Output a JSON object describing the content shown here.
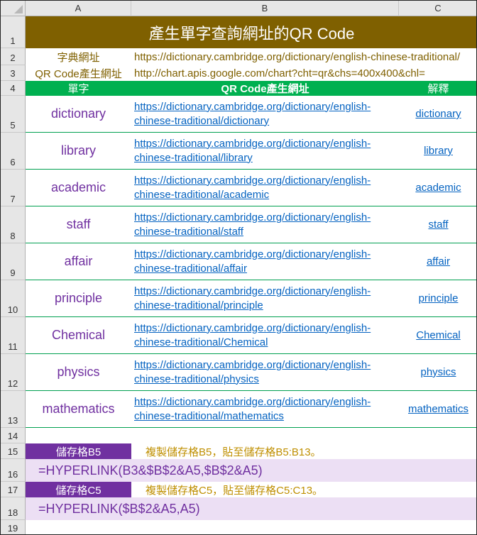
{
  "columns": [
    "A",
    "B",
    "C"
  ],
  "row_numbers": [
    "1",
    "2",
    "3",
    "4",
    "5",
    "6",
    "7",
    "8",
    "9",
    "10",
    "11",
    "12",
    "13",
    "14",
    "15",
    "16",
    "17",
    "18",
    "19"
  ],
  "title": "產生單字查詢網址的QR Code",
  "row2": {
    "label": "字典網址",
    "value": "https://dictionary.cambridge.org/dictionary/english-chinese-traditional/"
  },
  "row3": {
    "label": "QR Code產生網址",
    "value": "http://chart.apis.google.com/chart?cht=qr&chs=400x400&chl="
  },
  "table_header": {
    "word": "單字",
    "url": "QR Code產生網址",
    "meaning": "解釋"
  },
  "rows": [
    {
      "word": "dictionary",
      "url_line1": "https://dictionary.cambridge.org/dictionary/english-",
      "url_line2": "chinese-traditional/dictionary",
      "link": "dictionary"
    },
    {
      "word": "library",
      "url_line1": "https://dictionary.cambridge.org/dictionary/english-",
      "url_line2": "chinese-traditional/library",
      "link": "library"
    },
    {
      "word": "academic",
      "url_line1": "https://dictionary.cambridge.org/dictionary/english-",
      "url_line2": "chinese-traditional/academic",
      "link": "academic"
    },
    {
      "word": "staff",
      "url_line1": "https://dictionary.cambridge.org/dictionary/english-",
      "url_line2": "chinese-traditional/staff",
      "link": "staff"
    },
    {
      "word": "affair",
      "url_line1": "https://dictionary.cambridge.org/dictionary/english-",
      "url_line2": "chinese-traditional/affair",
      "link": "affair"
    },
    {
      "word": "principle",
      "url_line1": "https://dictionary.cambridge.org/dictionary/english-",
      "url_line2": "chinese-traditional/principle",
      "link": "principle"
    },
    {
      "word": "Chemical",
      "url_line1": "https://dictionary.cambridge.org/dictionary/english-",
      "url_line2": "chinese-traditional/Chemical",
      "link": "Chemical"
    },
    {
      "word": "physics",
      "url_line1": "https://dictionary.cambridge.org/dictionary/english-",
      "url_line2": "chinese-traditional/physics",
      "link": "physics"
    },
    {
      "word": "mathematics",
      "url_line1": "https://dictionary.cambridge.org/dictionary/english-",
      "url_line2": "chinese-traditional/mathematics",
      "link": "mathematics"
    }
  ],
  "notes": {
    "b5_label": "儲存格B5",
    "b5_note": "複製儲存格B5，貼至儲存格B5:B13。",
    "b5_formula": "=HYPERLINK(B3&$B$2&A5,$B$2&A5)",
    "c5_label": "儲存格C5",
    "c5_note": "複製儲存格C5，貼至儲存格C5:C13。",
    "c5_formula": "=HYPERLINK($B$2&A5,A5)"
  },
  "colors": {
    "title_bg": "#7f6000",
    "header_bg": "#00b050",
    "word_text": "#7030a0",
    "link_text": "#0563c1",
    "label_bar_bg": "#7030a0",
    "formula_bg": "#ecdff4",
    "note_text": "#bf8f00"
  }
}
